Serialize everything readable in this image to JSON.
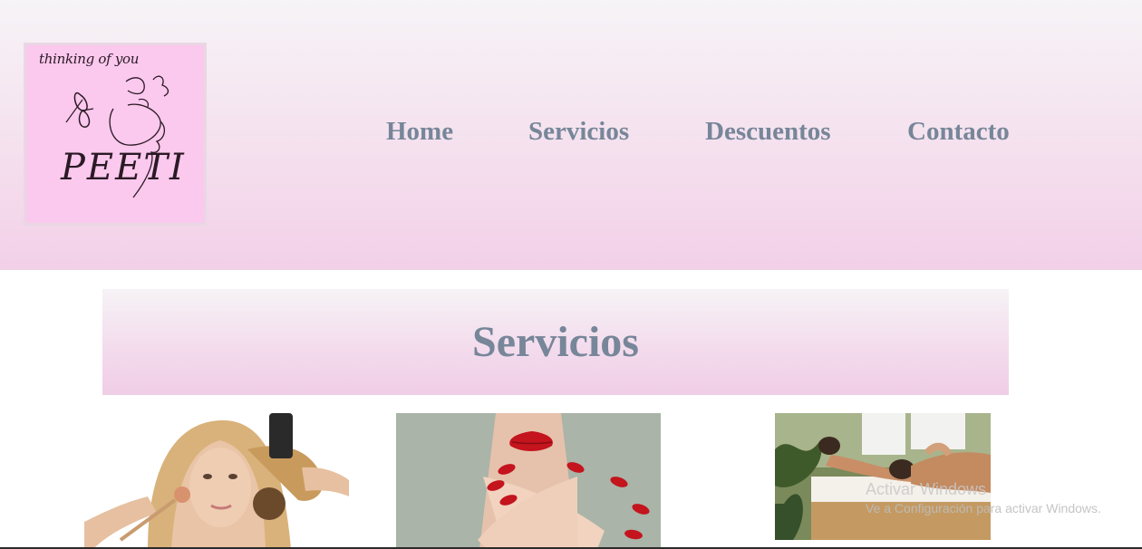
{
  "logo": {
    "tagline": "thinking of you",
    "brand": "PEETI",
    "background": "#fbc8ee"
  },
  "nav": {
    "items": [
      {
        "label": "Home"
      },
      {
        "label": "Servicios"
      },
      {
        "label": "Descuentos"
      },
      {
        "label": "Contacto"
      }
    ],
    "color": "#778699"
  },
  "section": {
    "title": "Servicios"
  },
  "service_images": [
    {
      "alt": "hair-and-makeup-image"
    },
    {
      "alt": "nails-image"
    },
    {
      "alt": "massage-image"
    }
  ],
  "watermark": {
    "title": "Activar Windows",
    "subtitle": "Ve a Configuración para activar Windows."
  }
}
